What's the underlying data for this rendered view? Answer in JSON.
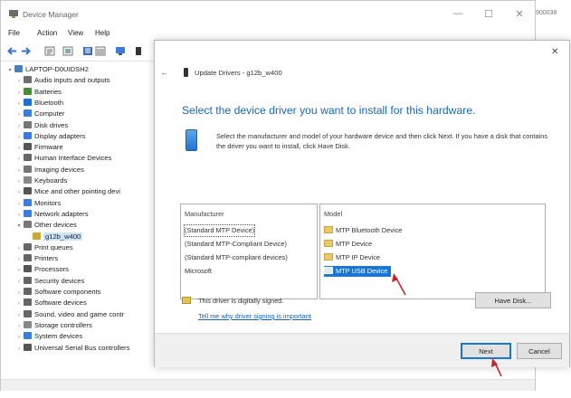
{
  "device_manager": {
    "title": "Device Manager",
    "window_controls": {
      "minimize": "—",
      "maximize": "☐",
      "close": "✕"
    },
    "menu": [
      "File",
      "Action",
      "View",
      "Help"
    ],
    "tree": [
      {
        "label": "LAPTOP-D0UIDSH2",
        "level": 0,
        "expander": "▾",
        "icon": "computer-icon",
        "color": "#4d7fb8"
      },
      {
        "label": "Audio inputs and outputs",
        "level": 1,
        "expander": "›",
        "icon": "speaker-icon",
        "color": "#6f6f6f"
      },
      {
        "label": "Batteries",
        "level": 1,
        "expander": "›",
        "icon": "battery-icon",
        "color": "#4a8a3a"
      },
      {
        "label": "Bluetooth",
        "level": 1,
        "expander": "›",
        "icon": "bluetooth-icon",
        "color": "#1f6fd1"
      },
      {
        "label": "Computer",
        "level": 1,
        "expander": "›",
        "icon": "computer-icon",
        "color": "#3b7dd8"
      },
      {
        "label": "Disk drives",
        "level": 1,
        "expander": "›",
        "icon": "disk-icon",
        "color": "#777777"
      },
      {
        "label": "Display adapters",
        "level": 1,
        "expander": "›",
        "icon": "display-icon",
        "color": "#3b7dd8"
      },
      {
        "label": "Firmware",
        "level": 1,
        "expander": "›",
        "icon": "firmware-icon",
        "color": "#555555"
      },
      {
        "label": "Human Interface Devices",
        "level": 1,
        "expander": "›",
        "icon": "hid-icon",
        "color": "#666666"
      },
      {
        "label": "Imaging devices",
        "level": 1,
        "expander": "›",
        "icon": "camera-icon",
        "color": "#777777"
      },
      {
        "label": "Keyboards",
        "level": 1,
        "expander": "›",
        "icon": "keyboard-icon",
        "color": "#888888"
      },
      {
        "label": "Mice and other pointing devi",
        "level": 1,
        "expander": "›",
        "icon": "mouse-icon",
        "color": "#555555"
      },
      {
        "label": "Monitors",
        "level": 1,
        "expander": "›",
        "icon": "monitor-icon",
        "color": "#3b7dd8"
      },
      {
        "label": "Network adapters",
        "level": 1,
        "expander": "›",
        "icon": "network-icon",
        "color": "#3b7dd8"
      },
      {
        "label": "Other devices",
        "level": 1,
        "expander": "▾",
        "icon": "other-devices-icon",
        "color": "#777777"
      },
      {
        "label": "g12b_w400",
        "level": 2,
        "expander": "",
        "icon": "unknown-device-icon",
        "color": "#c9a93a",
        "selected": true
      },
      {
        "label": "Print queues",
        "level": 1,
        "expander": "›",
        "icon": "printer-icon",
        "color": "#666666"
      },
      {
        "label": "Printers",
        "level": 1,
        "expander": "›",
        "icon": "printer-icon",
        "color": "#666666"
      },
      {
        "label": "Processors",
        "level": 1,
        "expander": "›",
        "icon": "processor-icon",
        "color": "#555555"
      },
      {
        "label": "Security devices",
        "level": 1,
        "expander": "›",
        "icon": "security-icon",
        "color": "#666666"
      },
      {
        "label": "Software components",
        "level": 1,
        "expander": "›",
        "icon": "software-icon",
        "color": "#666666"
      },
      {
        "label": "Software devices",
        "level": 1,
        "expander": "›",
        "icon": "software-icon",
        "color": "#666666"
      },
      {
        "label": "Sound, video and game contr",
        "level": 1,
        "expander": "›",
        "icon": "speaker-icon",
        "color": "#666666"
      },
      {
        "label": "Storage controllers",
        "level": 1,
        "expander": "›",
        "icon": "storage-icon",
        "color": "#888888"
      },
      {
        "label": "System devices",
        "level": 1,
        "expander": "›",
        "icon": "system-icon",
        "color": "#3b7dd8"
      },
      {
        "label": "Universal Serial Bus controllers",
        "level": 1,
        "expander": "›",
        "icon": "usb-icon",
        "color": "#555555"
      }
    ],
    "edge_text": "900038"
  },
  "dialog": {
    "close": "✕",
    "back": "←",
    "title": "Update Drivers - g12b_w400",
    "heading": "Select the device driver you want to install for this hardware.",
    "description": "Select the manufacturer and model of your hardware device and then click Next. If you have a disk that contains the driver you want to install, click Have Disk.",
    "manufacturer": {
      "header": "Manufacturer",
      "items": [
        "(Standard MTP Device)",
        "(Standard MTP-Compliant Device)",
        "(Standard MTP-compliant devices)",
        "Microsoft"
      ],
      "selected_index": 0
    },
    "model": {
      "header": "Model",
      "items": [
        "MTP Bluetooth Device",
        "MTP Device",
        "MTP IP Device",
        "MTP USB Device"
      ],
      "selected_index": 3
    },
    "signed_text": "This driver is digitally signed.",
    "signing_link": "Tell me why driver signing is important",
    "have_disk": "Have Disk...",
    "next": "Next",
    "cancel": "Cancel"
  },
  "colors": {
    "accent": "#1976d2",
    "heading": "#1a67b7",
    "arrow": "#c0282d"
  }
}
